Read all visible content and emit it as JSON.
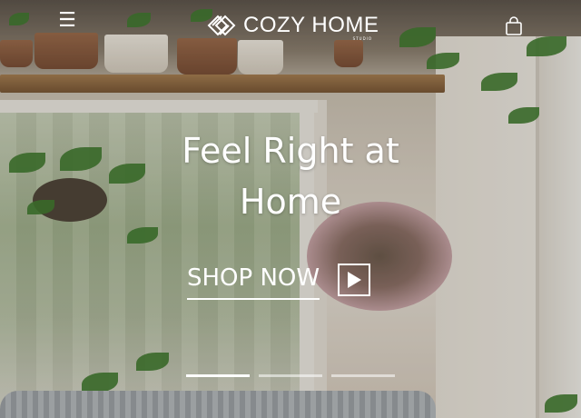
{
  "header": {
    "menu_icon": "hamburger-menu-icon",
    "menu_glyph": "☰",
    "logo_text": "COZY HOME",
    "logo_subtext": "STUDIO",
    "cart_icon": "shopping-bag-icon"
  },
  "hero": {
    "headline_line1": "Feel Right at",
    "headline_line2": "Home",
    "cta_label": "SHOP NOW",
    "cta_icon": "play-icon"
  },
  "carousel": {
    "slides": 3,
    "active_index": 0
  },
  "colors": {
    "text": "#ffffff",
    "shelf": "#8a6440",
    "leaf": "#3f7a2d"
  }
}
